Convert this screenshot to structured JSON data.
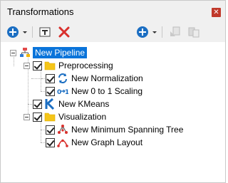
{
  "panel": {
    "title": "Transformations"
  },
  "toolbar": {
    "add_icon": "plus-circle-icon",
    "dropdown_icon": "chevron-down-icon",
    "rename_icon": "rename-icon",
    "delete_icon": "delete-x-icon",
    "add_right_icon": "plus-circle-icon",
    "copy_icon": "copy-icon",
    "paste_icon": "paste-icon"
  },
  "tree": {
    "root": {
      "label": "New Pipeline",
      "icon": "pipeline-icon",
      "selected": true
    },
    "preprocessing": {
      "label": "Preprocessing",
      "items": [
        {
          "label": "New Normalization",
          "icon": "normalization-icon"
        },
        {
          "label": "New 0 to 1 Scaling",
          "icon": "scaling-icon"
        }
      ]
    },
    "kmeans": {
      "label": "New KMeans",
      "icon": "kmeans-icon"
    },
    "visualization": {
      "label": "Visualization",
      "items": [
        {
          "label": "New Minimum Spanning Tree",
          "icon": "spanning-tree-icon"
        },
        {
          "label": "New Graph Layout",
          "icon": "graph-layout-icon"
        }
      ]
    }
  },
  "colors": {
    "accent": "#0a74da",
    "folder": "#f5c518",
    "delete": "#d9302c"
  }
}
